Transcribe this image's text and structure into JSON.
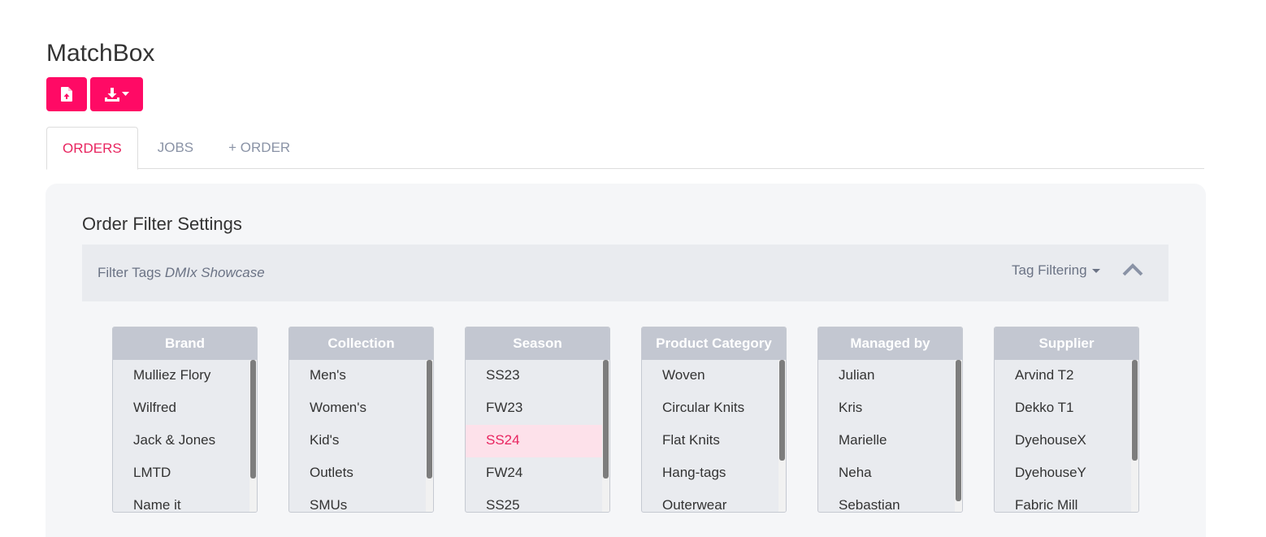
{
  "app": {
    "title": "MatchBox"
  },
  "toolbar": {
    "upload_icon": "file-upload-icon",
    "download_icon": "download-icon",
    "accent_color": "#ff0a65"
  },
  "tabs": [
    {
      "label": "ORDERS",
      "active": true
    },
    {
      "label": "JOBS",
      "active": false
    },
    {
      "label": "+ ORDER",
      "active": false
    }
  ],
  "filter_panel": {
    "title": "Order Filter Settings",
    "filter_tags_label": "Filter Tags",
    "filter_tags_value": "DMIx Showcase",
    "tag_filtering_label": "Tag Filtering",
    "collapse_icon": "chevron-up-icon"
  },
  "lists": [
    {
      "header": "Brand",
      "items": [
        "Mulliez Flory",
        "Wilfred",
        "Jack & Jones",
        "LMTD",
        "Name it"
      ],
      "selected": null
    },
    {
      "header": "Collection",
      "items": [
        "Men's",
        "Women's",
        "Kid's",
        "Outlets",
        "SMUs"
      ],
      "selected": null
    },
    {
      "header": "Season",
      "items": [
        "SS23",
        "FW23",
        "SS24",
        "FW24",
        "SS25"
      ],
      "selected": "SS24"
    },
    {
      "header": "Product Category",
      "items": [
        "Woven",
        "Circular Knits",
        "Flat Knits",
        "Hang-tags",
        "Outerwear"
      ],
      "selected": null
    },
    {
      "header": "Managed by",
      "items": [
        "Julian",
        "Kris",
        "Marielle",
        "Neha",
        "Sebastian"
      ],
      "selected": null
    },
    {
      "header": "Supplier",
      "items": [
        "Arvind T2",
        "Dekko T1",
        "DyehouseX",
        "DyehouseY",
        "Fabric Mill"
      ],
      "selected": null
    }
  ]
}
